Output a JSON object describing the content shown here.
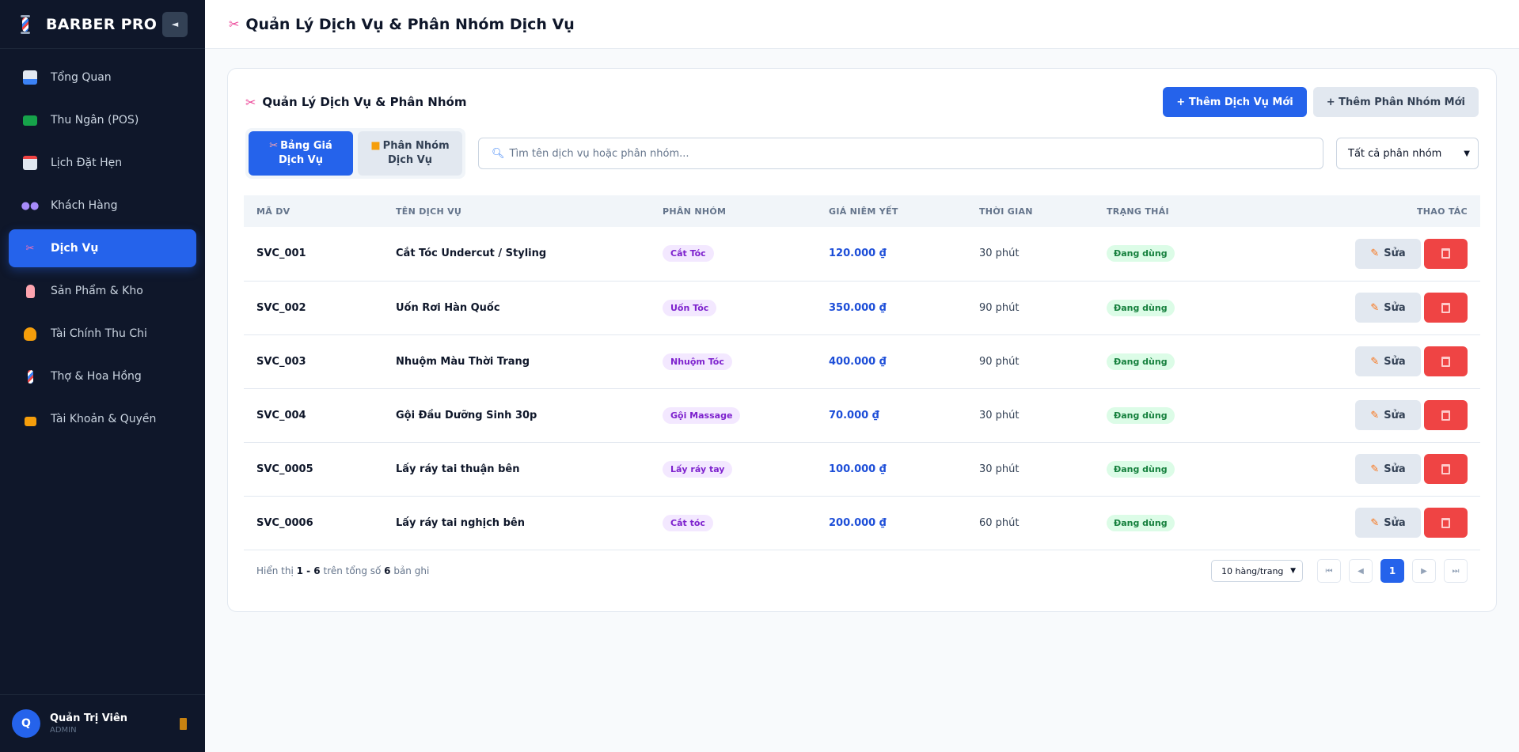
{
  "app": {
    "brand": "BARBER PRO",
    "collapse_glyph": "◄"
  },
  "sidebar": {
    "items": [
      {
        "label": "Tổng Quan",
        "icon": "chart-icon"
      },
      {
        "label": "Thu Ngân (POS)",
        "icon": "money-icon"
      },
      {
        "label": "Lịch Đặt Hẹn",
        "icon": "calendar-icon"
      },
      {
        "label": "Khách Hàng",
        "icon": "users-icon"
      },
      {
        "label": "Dịch Vụ",
        "icon": "scissors-icon",
        "active": true
      },
      {
        "label": "Sản Phẩm & Kho",
        "icon": "bottle-icon"
      },
      {
        "label": "Tài Chính Thu Chi",
        "icon": "money-bag-icon"
      },
      {
        "label": "Thợ & Hoa Hồng",
        "icon": "barber-pole-icon"
      },
      {
        "label": "Tài Khoản & Quyền",
        "icon": "lock-icon"
      }
    ]
  },
  "user": {
    "initial": "Q",
    "name": "Quản Trị Viên",
    "role": "ADMIN"
  },
  "header": {
    "title": "Quản Lý Dịch Vụ & Phân Nhóm Dịch Vụ"
  },
  "card": {
    "title": "Quản Lý Dịch Vụ & Phân Nhóm",
    "add_service_label": "+ Thêm Dịch Vụ Mới",
    "add_group_label": "+ Thêm Phân Nhóm Mới"
  },
  "tabs": [
    {
      "line1": "Bảng Giá",
      "line2": "Dịch Vụ",
      "active": true
    },
    {
      "line1": "Phân Nhóm",
      "line2": "Dịch Vụ",
      "active": false
    }
  ],
  "search": {
    "placeholder": "Tìm tên dịch vụ hoặc phân nhóm..."
  },
  "filter": {
    "selected": "Tất cả phân nhóm"
  },
  "table": {
    "columns": [
      "MÃ DV",
      "TÊN DỊCH VỤ",
      "PHÂN NHÓM",
      "GIÁ NIÊM YẾT",
      "THỜI GIAN",
      "TRẠNG THÁI",
      "THAO TÁC"
    ],
    "edit_label": "Sửa",
    "rows": [
      {
        "code": "SVC_001",
        "name": "Cắt Tóc Undercut / Styling",
        "group": "Cắt Tóc",
        "price": "120.000 ₫",
        "duration": "30 phút",
        "status": "Đang dùng"
      },
      {
        "code": "SVC_002",
        "name": "Uốn Rơi Hàn Quốc",
        "group": "Uốn Tóc",
        "price": "350.000 ₫",
        "duration": "90 phút",
        "status": "Đang dùng"
      },
      {
        "code": "SVC_003",
        "name": "Nhuộm Màu Thời Trang",
        "group": "Nhuộm Tóc",
        "price": "400.000 ₫",
        "duration": "90 phút",
        "status": "Đang dùng"
      },
      {
        "code": "SVC_004",
        "name": "Gội Đầu Dưỡng Sinh 30p",
        "group": "Gội Massage",
        "price": "70.000 ₫",
        "duration": "30 phút",
        "status": "Đang dùng"
      },
      {
        "code": "SVC_0005",
        "name": "Lấy ráy tai thuận bên",
        "group": "Lấy ráy tay",
        "price": "100.000 ₫",
        "duration": "30 phút",
        "status": "Đang dùng"
      },
      {
        "code": "SVC_0006",
        "name": "Lấy ráy tai nghịch bên",
        "group": "Cắt tóc",
        "price": "200.000 ₫",
        "duration": "60 phút",
        "status": "Đang dùng"
      }
    ]
  },
  "pagination": {
    "prefix": "Hiển thị ",
    "range": "1 - 6",
    "middle": " trên tổng số ",
    "total": "6",
    "suffix": " bản ghi",
    "per_page": "10 hàng/trang",
    "current_page": "1",
    "first": "⏮",
    "prev": "◀",
    "next": "▶",
    "last": "⏭"
  },
  "colors": {
    "accent": "#2563eb",
    "sidebar_bg": "#0f172a",
    "danger": "#ef4444",
    "status_green": "#15803d",
    "group_purple": "#7e22ce"
  }
}
